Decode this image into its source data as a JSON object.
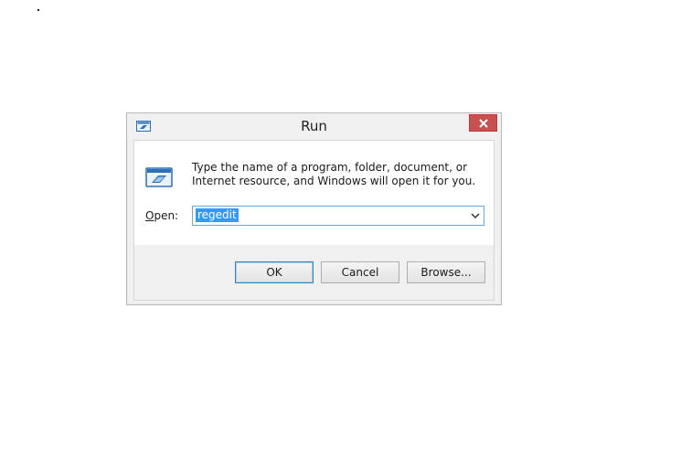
{
  "window": {
    "title": "Run",
    "close_label": "Close"
  },
  "dialog": {
    "description": "Type the name of a program, folder, document, or Internet resource, and Windows will open it for you.",
    "open_label_accel": "O",
    "open_label_rest": "pen:",
    "open_value": "regedit"
  },
  "buttons": {
    "ok": "OK",
    "cancel": "Cancel",
    "browse": "Browse..."
  },
  "icons": {
    "title": "run-icon",
    "main": "run-icon",
    "close": "close-icon",
    "dropdown": "chevron-down-icon"
  },
  "colors": {
    "close_button": "#c75050",
    "selection": "#3399ff",
    "focus_border": "#6fa7d8"
  }
}
